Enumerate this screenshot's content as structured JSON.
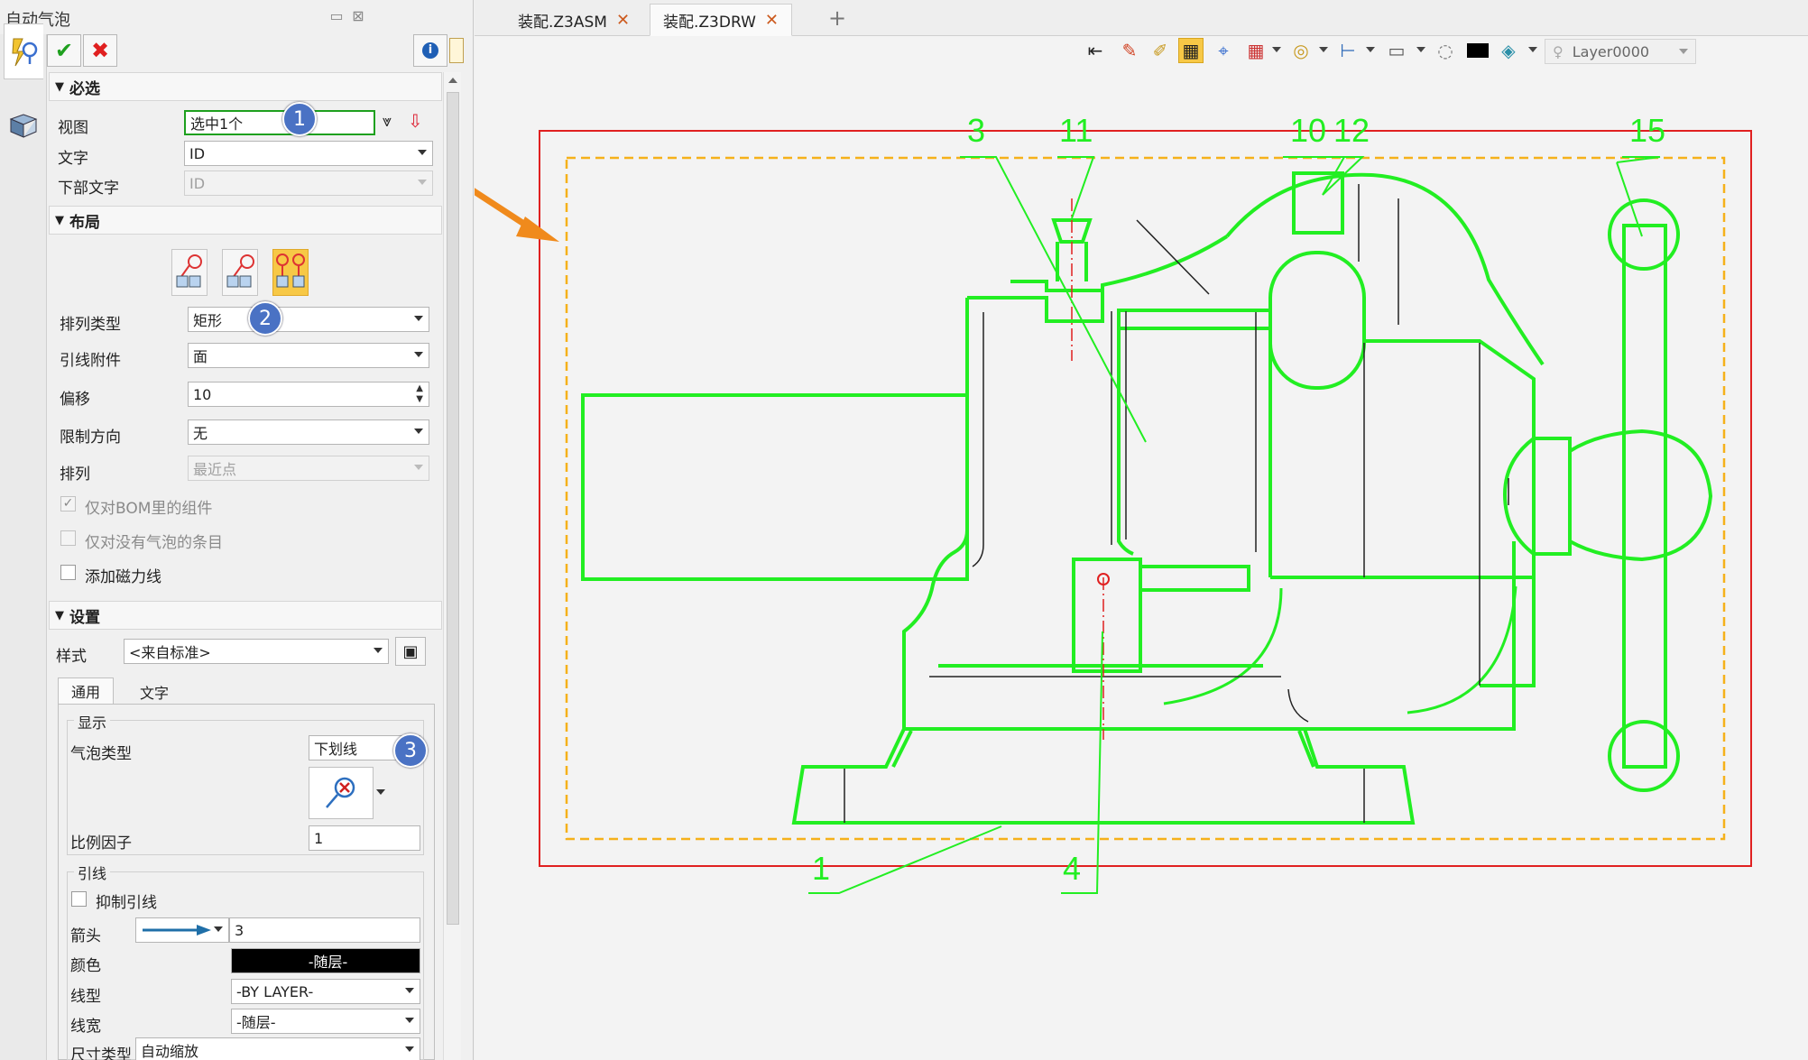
{
  "panel": {
    "title": "自动气泡",
    "pin_icon": "pin-icon",
    "close_icon": "close-icon"
  },
  "toolbar": {
    "ok_icon": "check-icon",
    "cancel_icon": "cross-icon",
    "info_icon": "info-icon"
  },
  "required": {
    "header": "必选",
    "view_label": "视图",
    "view_value": "选中1个",
    "text_label": "文字",
    "text_value": "ID",
    "lower_text_label": "下部文字",
    "lower_text_value": "ID"
  },
  "layout": {
    "header": "布局",
    "arrange_type_label": "排列类型",
    "arrange_type_value": "矩形",
    "leader_attach_label": "引线附件",
    "leader_attach_value": "面",
    "offset_label": "偏移",
    "offset_value": "10",
    "limit_dir_label": "限制方向",
    "limit_dir_value": "无",
    "arrange_label": "排列",
    "arrange_value": "最近点",
    "cb_bom_label": "仅对BOM里的组件",
    "cb_bom_checked": true,
    "cb_nobubble_label": "仅对没有气泡的条目",
    "cb_nobubble_checked": false,
    "cb_magnet_label": "添加磁力线",
    "cb_magnet_checked": false
  },
  "settings": {
    "header": "设置",
    "style_label": "样式",
    "style_value": "<来自标准>",
    "tab_general": "通用",
    "tab_text": "文字",
    "display_group": "显示",
    "bubble_type_label": "气泡类型",
    "bubble_type_value": "下划线",
    "scale_label": "比例因子",
    "scale_value": "1",
    "leader_group": "引线",
    "suppress_leader_label": "抑制引线",
    "arrow_label": "箭头",
    "arrow_size": "3",
    "color_label": "颜色",
    "color_value": "-随层-",
    "linetype_label": "线型",
    "linetype_value": "-BY LAYER-",
    "linewidth_label": "线宽",
    "linewidth_value": "-随层-",
    "size_type_label": "尺寸类型",
    "size_type_value": "自动缩放"
  },
  "badges": [
    "1",
    "2",
    "3"
  ],
  "tabs": [
    {
      "label": "装配.Z3ASM"
    },
    {
      "label": "装配.Z3DRW"
    }
  ],
  "add_tab": "+",
  "layer": {
    "name": "Layer0000"
  },
  "balloons": [
    "3",
    "11",
    "10",
    "12",
    "15",
    "1",
    "4"
  ],
  "colors": {
    "drawing_green": "#22ee22",
    "frame_red": "#e02020",
    "border_orange": "#f5b11a",
    "arrow_orange": "#f08a1c",
    "badge_blue": "#4a72c4",
    "active_yellow": "#f7c846"
  }
}
